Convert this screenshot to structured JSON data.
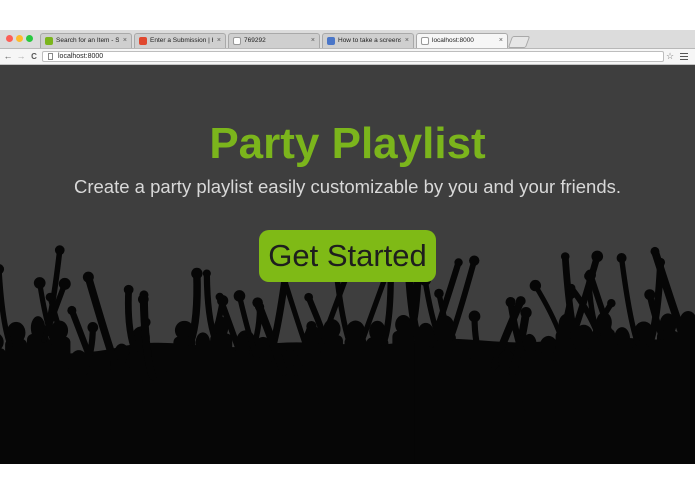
{
  "browser": {
    "tabs": [
      {
        "title": "Search for an Item - Spoti",
        "favicon_color": "#7bb51c",
        "close": "×"
      },
      {
        "title": "Enter a Submission | Hack",
        "favicon_color": "#e0482f",
        "close": "×"
      },
      {
        "title": "769292",
        "favicon_color": "#ffffff",
        "close": "×"
      },
      {
        "title": "How to take a screenshot",
        "favicon_color": "#4a76c8",
        "close": "×"
      },
      {
        "title": "localhost:8000",
        "favicon_color": "#ffffff",
        "close": "×"
      }
    ],
    "active_tab": 4,
    "url": "localhost:8000",
    "back_glyph": "←",
    "forward_glyph": "→",
    "reload_glyph": "C",
    "star_glyph": "☆"
  },
  "hero": {
    "title": "Party Playlist",
    "subtitle": "Create a party playlist easily customizable by you and your friends.",
    "cta_label": "Get Started"
  },
  "colors": {
    "background": "#3e3e3e",
    "accent": "#7bb51c",
    "button": "#7fba16",
    "crowd": "#060606"
  }
}
